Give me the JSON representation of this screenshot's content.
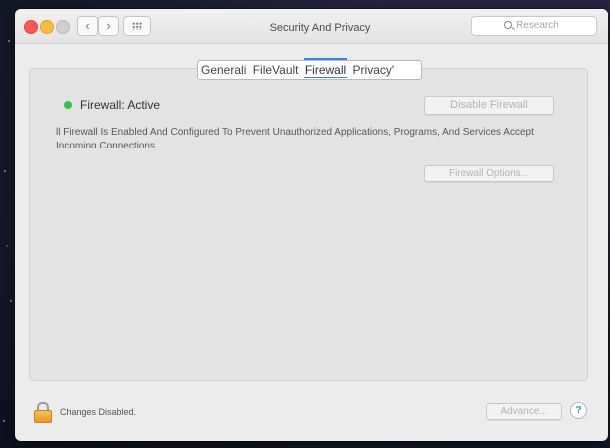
{
  "window": {
    "title": "Security And Privacy",
    "search_placeholder": "Research"
  },
  "nav": {
    "back_icon": "‹",
    "forward_icon": "›"
  },
  "tabs": [
    {
      "label": "Generali"
    },
    {
      "label": "FileVault"
    },
    {
      "label": "Firewall",
      "active": true
    },
    {
      "label": "Privacy'"
    }
  ],
  "firewall": {
    "status_text": "Firewall: Active",
    "status_color": "#35c24a",
    "disable_button": "Disable Firewall",
    "description": "ll Firewall Is Enabled And Configured To Prevent Unauthorized Applications, Programs, And Services Accept Incoming Connections.",
    "options_button": "Firewall Options..."
  },
  "footer": {
    "lock_text": "Changes Disabled.",
    "advanced_button": "Advance...",
    "help_label": "?"
  },
  "colors": {
    "accent": "#3b82e3",
    "lock": "#f0b445"
  }
}
